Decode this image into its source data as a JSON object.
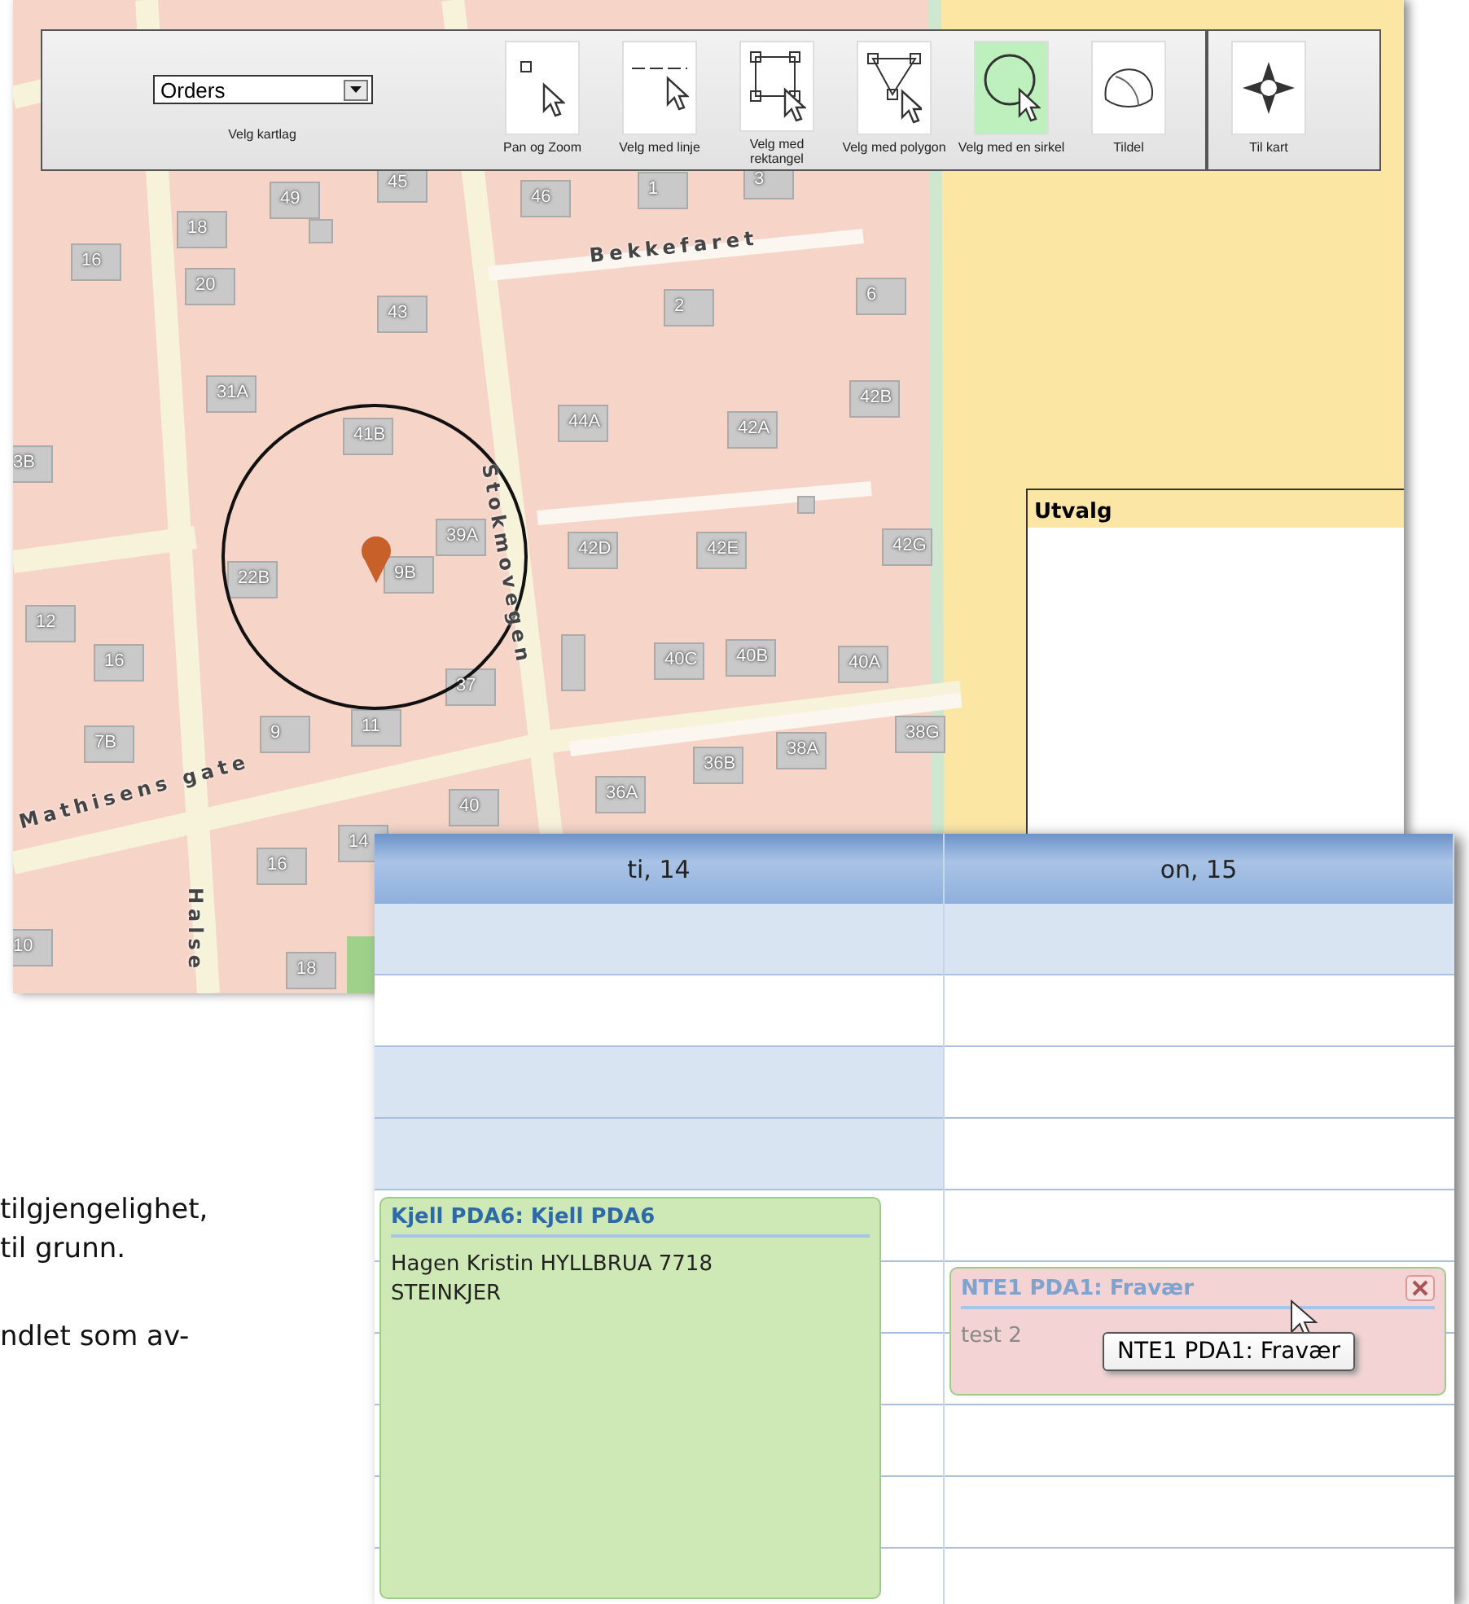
{
  "toolbar": {
    "layer_select": {
      "value": "Orders",
      "label": "Velg kartlag"
    },
    "tools": [
      {
        "kind": "pan",
        "label": "Pan og Zoom",
        "selected": false
      },
      {
        "kind": "line",
        "label": "Velg med linje",
        "selected": false
      },
      {
        "kind": "rectangle",
        "label": "Velg med rektangel",
        "selected": false
      },
      {
        "kind": "polygon",
        "label": "Velg med polygon",
        "selected": false
      },
      {
        "kind": "circle",
        "label": "Velg med en sirkel",
        "selected": true
      },
      {
        "kind": "assign",
        "label": "Tildel",
        "selected": false
      }
    ],
    "nav_tool": {
      "label": "Til kart"
    }
  },
  "map": {
    "streets": [
      "Bekkefaret",
      "Stokmovegen",
      "Mathisens gate",
      "Halse"
    ],
    "labels": [
      "49",
      "45",
      "46",
      "1",
      "3",
      "18",
      "16",
      "20",
      "43",
      "2",
      "6",
      "31A",
      "41B",
      "44A",
      "42A",
      "42B",
      "3B",
      "39A",
      "22B",
      "9B",
      "42D",
      "42E",
      "42G",
      "12",
      "16",
      "40C",
      "40B",
      "40A",
      "37",
      "11",
      "9",
      "7B",
      "38G",
      "38A",
      "36B",
      "36A",
      "40",
      "14",
      "16",
      "10",
      "18"
    ]
  },
  "selection_panel": {
    "title": "Utvalg"
  },
  "page_text": [
    "tilgjengelighet,",
    "til grunn.",
    "ndlet som av-"
  ],
  "calendar": {
    "days": [
      "ti, 14",
      "on, 15"
    ],
    "appointments": [
      {
        "title": "Kjell PDA6: Kjell PDA6",
        "body": "Hagen Kristin HYLLBRUA 7718 STEINKJER",
        "color": "#cfe9b6",
        "closable": false
      },
      {
        "title": "NTE1 PDA1: Fravær",
        "body": "test 2",
        "color": "#f3d3d3",
        "closable": true
      }
    ],
    "tooltip": "NTE1 PDA1: Fravær"
  }
}
